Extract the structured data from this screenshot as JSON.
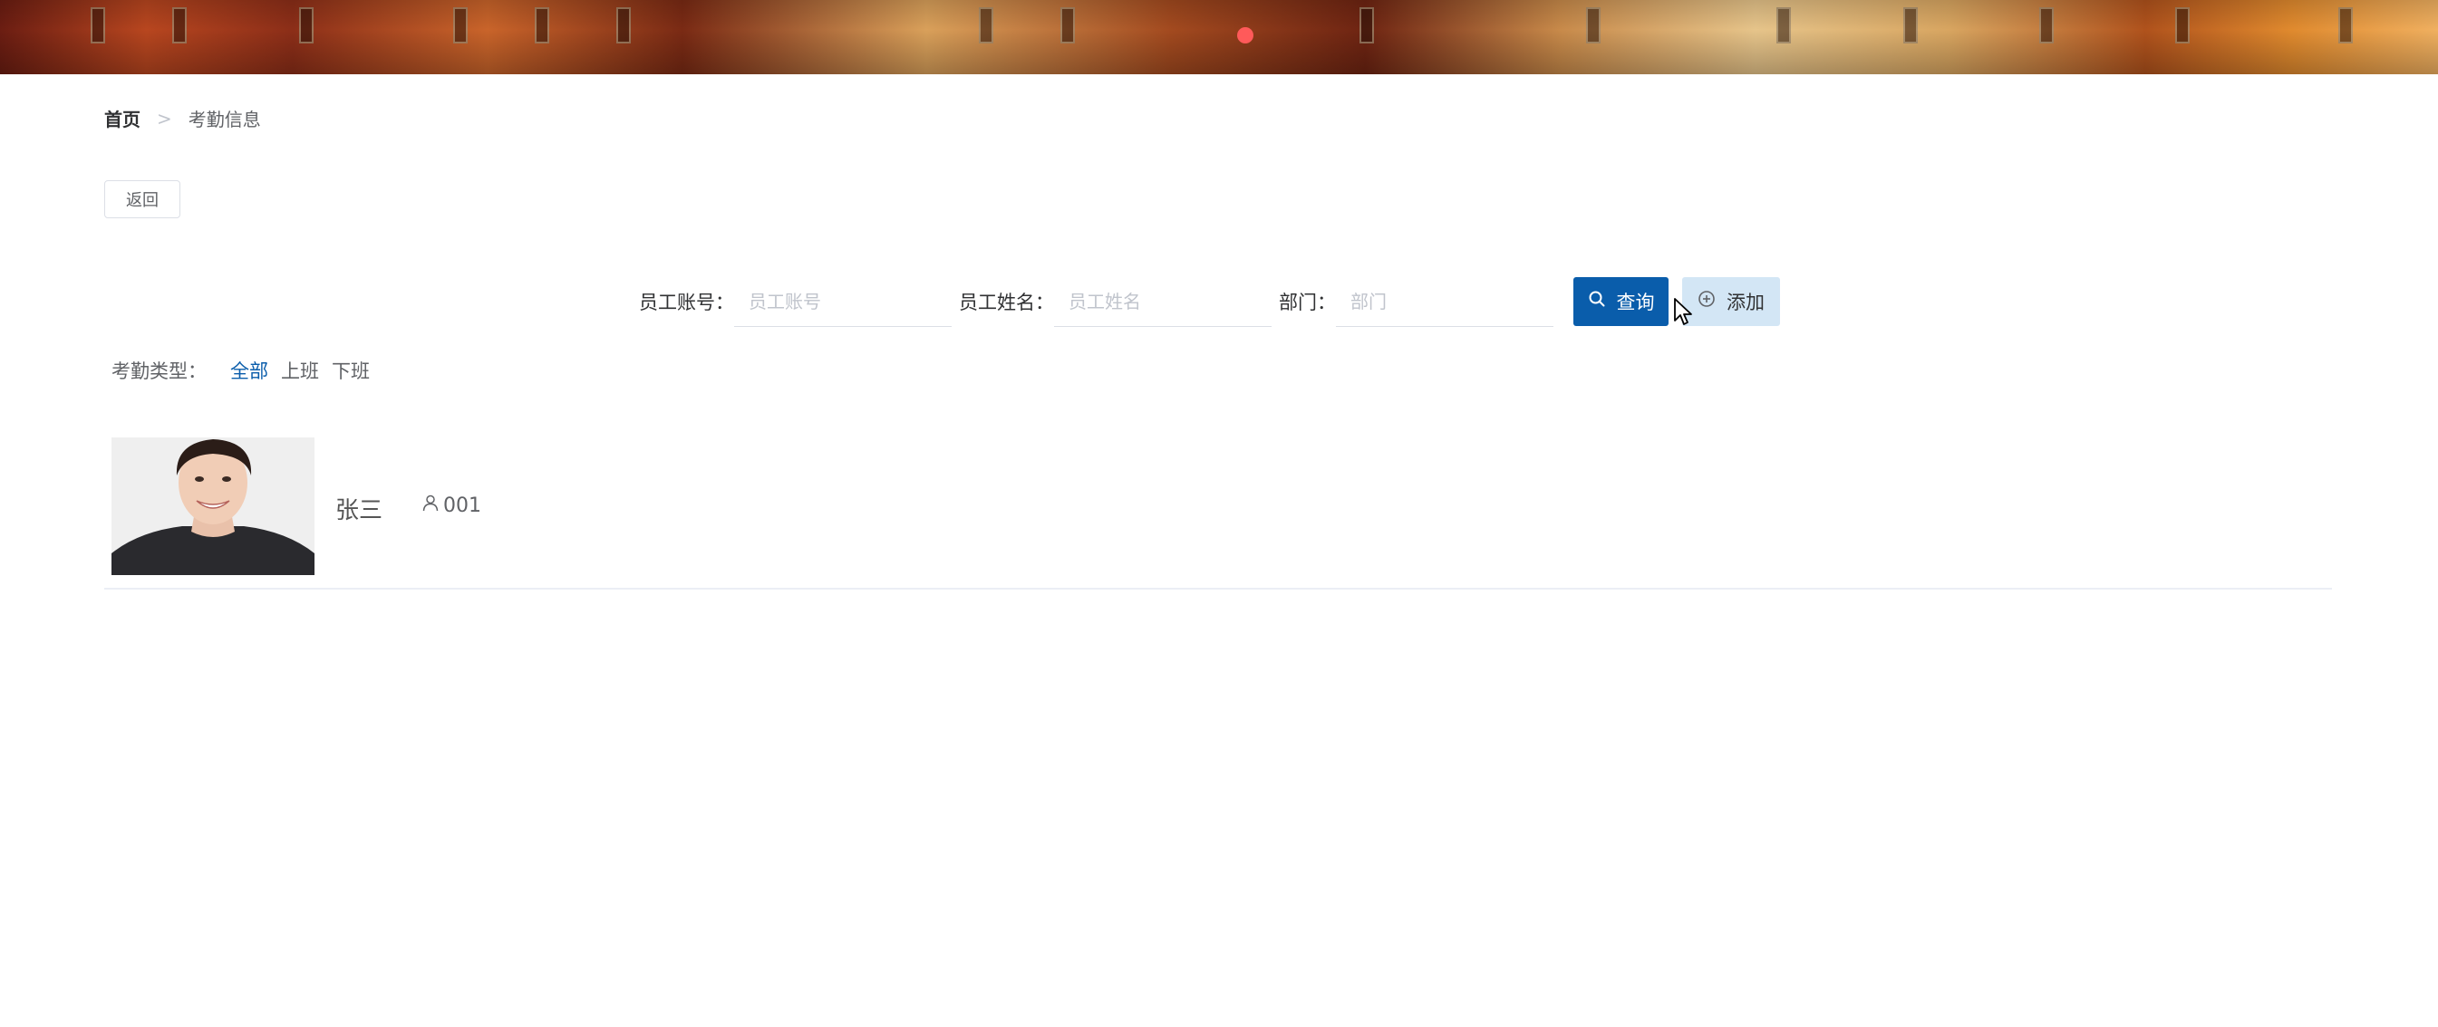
{
  "breadcrumb": {
    "home": "首页",
    "separator": ">",
    "current": "考勤信息"
  },
  "back_button": "返回",
  "search": {
    "account_label": "员工账号：",
    "account_placeholder": "员工账号",
    "name_label": "员工姓名：",
    "name_placeholder": "员工姓名",
    "dept_label": "部门：",
    "dept_placeholder": "部门",
    "query_label": "查询",
    "add_label": "添加"
  },
  "filter": {
    "label": "考勤类型：",
    "options": [
      "全部",
      "上班",
      "下班"
    ],
    "active_index": 0
  },
  "records": [
    {
      "name": "张三",
      "account": "001"
    }
  ],
  "colors": {
    "primary": "#0a5dab",
    "add_bg": "#d3e6f5"
  },
  "icons": {
    "query": "search-icon",
    "add": "plus-circle-icon",
    "account": "user-icon"
  }
}
